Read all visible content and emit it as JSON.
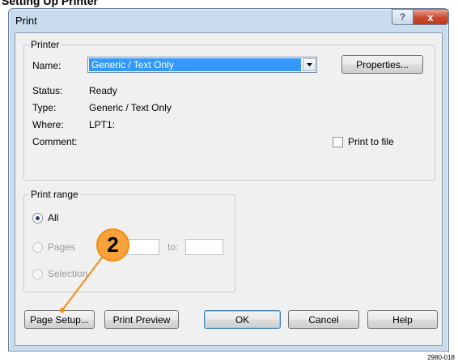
{
  "caption": "Setting Up Printer",
  "dialog": {
    "title": "Print",
    "help_glyph": "?",
    "close_glyph": "x"
  },
  "printer": {
    "group_label": "Printer",
    "name_label": "Name:",
    "name_value": "Generic / Text Only",
    "properties_button": "Properties...",
    "status_label": "Status:",
    "status_value": "Ready",
    "type_label": "Type:",
    "type_value": "Generic / Text Only",
    "where_label": "Where:",
    "where_value": "LPT1:",
    "comment_label": "Comment:",
    "print_to_file_label": "Print to file",
    "print_to_file_checked": false
  },
  "print_range": {
    "group_label": "Print range",
    "all_label": "All",
    "pages_label": "Pages",
    "to_label": "to:",
    "selection_label": "Selection",
    "selected": "all"
  },
  "buttons": {
    "page_setup": "Page Setup...",
    "print_preview": "Print Preview",
    "ok": "OK",
    "cancel": "Cancel",
    "help": "Help"
  },
  "callout": {
    "number": "2",
    "color": "#f7a23a"
  },
  "figure_code": "2980-018",
  "colors": {
    "selection_highlight": "#3399ff",
    "window_frame": "#c9dced",
    "close_button": "#c9482c"
  }
}
